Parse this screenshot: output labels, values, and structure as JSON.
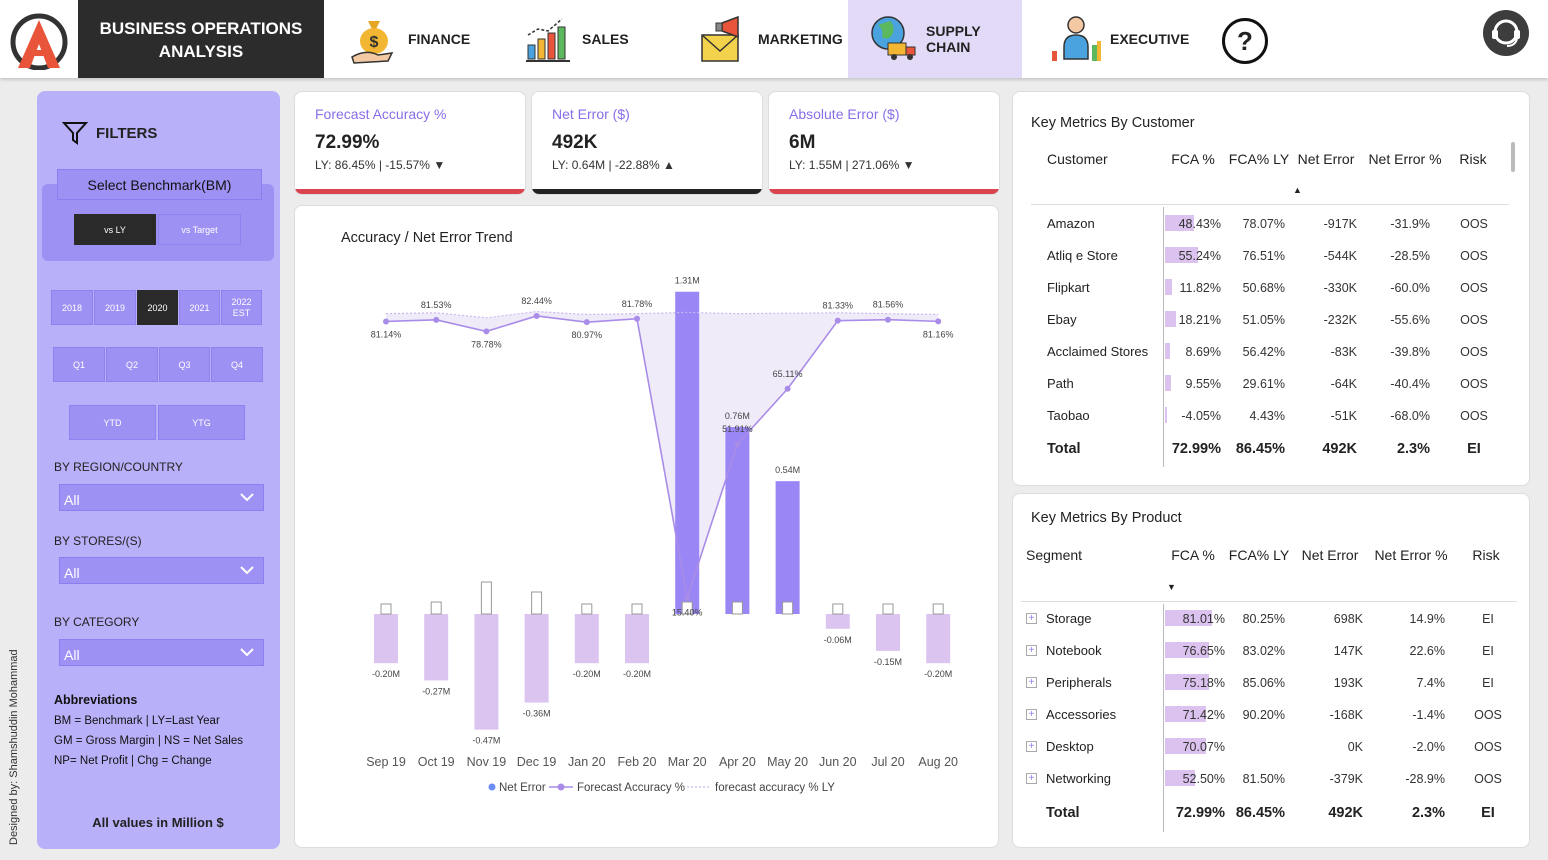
{
  "header": {
    "title_line1": "BUSINESS OPERATIONS",
    "title_line2": "ANALYSIS",
    "tabs": [
      {
        "label": "FINANCE"
      },
      {
        "label": "SALES"
      },
      {
        "label": "MARKETING"
      },
      {
        "label": "SUPPLY CHAIN",
        "active": true
      },
      {
        "label": "EXECUTIVE"
      }
    ],
    "help": "?"
  },
  "sidebar": {
    "filters_label": "FILTERS",
    "benchmark_title": "Select Benchmark(BM)",
    "benchmark_options": [
      "vs LY",
      "vs Target"
    ],
    "benchmark_selected": "vs LY",
    "years": [
      "2018",
      "2019",
      "2020",
      "2021",
      "2022 EST"
    ],
    "year_selected": "2020",
    "quarters": [
      "Q1",
      "Q2",
      "Q3",
      "Q4"
    ],
    "periods": [
      "YTD",
      "YTG"
    ],
    "region_label": "BY REGION/COUNTRY",
    "region_value": "All",
    "stores_label": "BY STORES/(S)",
    "stores_value": "All",
    "category_label": "BY CATEGORY",
    "category_value": "All",
    "abbr_title": "Abbreviations",
    "abbr_lines": [
      "BM = Benchmark | LY=Last Year",
      "GM = Gross Margin | NS = Net Sales",
      "NP= Net Profit | Chg = Change"
    ],
    "note": "All values in Million $",
    "designer": "Designed by: Shamshuddin Mohammad"
  },
  "kpis": [
    {
      "title": "Forecast Accuracy %",
      "value": "72.99%",
      "sub": "LY: 86.45% | -15.57%",
      "arrow": "▼",
      "bar_color": "#d9444f"
    },
    {
      "title": "Net Error ($)",
      "value": "492K",
      "sub": "LY: 0.64M | -22.88%",
      "arrow": "▲",
      "bar_color": "#222222"
    },
    {
      "title": "Absolute Error ($)",
      "value": "6M",
      "sub": "LY: 1.55M | 271.06%",
      "arrow": "▼",
      "bar_color": "#d9444f"
    }
  ],
  "chart_data": {
    "type": "bar",
    "title": "Accuracy / Net Error Trend",
    "categories": [
      "Sep 19",
      "Oct 19",
      "Nov 19",
      "Dec 19",
      "Jan 20",
      "Feb 20",
      "Mar 20",
      "Apr 20",
      "May 20",
      "Jun 20",
      "Jul 20",
      "Aug 20"
    ],
    "series": [
      {
        "name": "Net Error",
        "type": "bar",
        "values": [
          -0.2,
          -0.27,
          -0.47,
          -0.36,
          -0.2,
          -0.2,
          1.31,
          0.76,
          0.54,
          -0.06,
          -0.15,
          -0.2
        ],
        "labels": [
          "-0.20M",
          "-0.27M",
          "-0.47M",
          "-0.36M",
          "-0.20M",
          "-0.20M",
          "1.31M",
          "0.76M",
          "0.54M",
          "-0.06M",
          "-0.15M",
          "-0.20M"
        ]
      },
      {
        "name": "Forecast Accuracy %",
        "type": "line",
        "values": [
          81.14,
          81.53,
          78.78,
          82.44,
          80.97,
          81.78,
          15.4,
          51.91,
          65.11,
          81.33,
          81.56,
          81.16
        ],
        "labels": [
          "81.14%",
          "81.53%",
          "78.78%",
          "82.44%",
          "80.97%",
          "81.78%",
          "15.40%",
          "51.91%",
          "65.11%",
          "81.33%",
          "81.56%",
          "81.16%"
        ]
      },
      {
        "name": "forecast accuracy % LY",
        "type": "line",
        "values": [
          83.0,
          83.2,
          82.0,
          83.5,
          82.8,
          83.0,
          83.3,
          83.0,
          83.1,
          83.2,
          83.0,
          82.8
        ]
      }
    ],
    "ylim": [
      -0.55,
      1.4
    ],
    "legend": "bottom",
    "colors": {
      "neterror": "#9b86f5",
      "neterror_neg": "#dcc4f0",
      "fca": "#a98ce8",
      "ly": "#c9b8ef"
    }
  },
  "customer_table": {
    "title": "Key Metrics By Customer",
    "headers": [
      "Customer",
      "FCA %",
      "FCA% LY",
      "Net Error",
      "Net Error %",
      "Risk"
    ],
    "rows": [
      [
        "Amazon",
        "48.43%",
        "78.07%",
        "-917K",
        "-31.9%",
        "OOS"
      ],
      [
        "Atliq e Store",
        "55.24%",
        "76.51%",
        "-544K",
        "-28.5%",
        "OOS"
      ],
      [
        "Flipkart",
        "11.82%",
        "50.68%",
        "-330K",
        "-60.0%",
        "OOS"
      ],
      [
        "Ebay",
        "18.21%",
        "51.05%",
        "-232K",
        "-55.6%",
        "OOS"
      ],
      [
        "Acclaimed Stores",
        "8.69%",
        "56.42%",
        "-83K",
        "-39.8%",
        "OOS"
      ],
      [
        "Path",
        "9.55%",
        "29.61%",
        "-64K",
        "-40.4%",
        "OOS"
      ],
      [
        "Taobao",
        "-4.05%",
        "4.43%",
        "-51K",
        "-68.0%",
        "OOS"
      ]
    ],
    "fca_values": [
      48.43,
      55.24,
      11.82,
      18.21,
      8.69,
      9.55,
      -4.05
    ],
    "total": [
      "Total",
      "72.99%",
      "86.45%",
      "492K",
      "2.3%",
      "EI"
    ]
  },
  "product_table": {
    "title": "Key Metrics By Product",
    "headers": [
      "Segment",
      "FCA %",
      "FCA% LY",
      "Net Error",
      "Net Error %",
      "Risk"
    ],
    "rows": [
      [
        "Storage",
        "81.01%",
        "80.25%",
        "698K",
        "14.9%",
        "EI"
      ],
      [
        "Notebook",
        "76.65%",
        "83.02%",
        "147K",
        "22.6%",
        "EI"
      ],
      [
        "Peripherals",
        "75.18%",
        "85.06%",
        "193K",
        "7.4%",
        "EI"
      ],
      [
        "Accessories",
        "71.42%",
        "90.20%",
        "-168K",
        "-1.4%",
        "OOS"
      ],
      [
        "Desktop",
        "70.07%",
        "",
        "0K",
        "-2.0%",
        "OOS"
      ],
      [
        "Networking",
        "52.50%",
        "81.50%",
        "-379K",
        "-28.9%",
        "OOS"
      ]
    ],
    "fca_values": [
      81.01,
      76.65,
      75.18,
      71.42,
      70.07,
      52.5
    ],
    "total": [
      "Total",
      "72.99%",
      "86.45%",
      "492K",
      "2.3%",
      "EI"
    ]
  }
}
